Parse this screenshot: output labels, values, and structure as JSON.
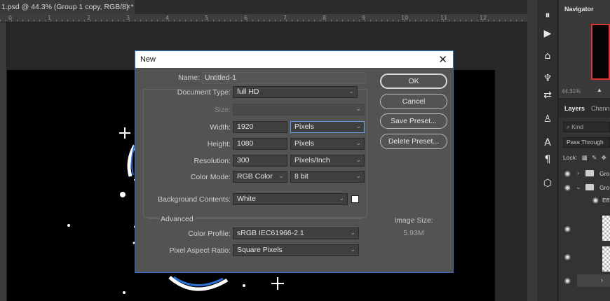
{
  "document_tab": {
    "title": "1.psd @ 44.3% (Group 1 copy, RGB/8) *",
    "close": "×"
  },
  "ruler": {
    "numbers": [
      "0",
      "1",
      "2",
      "3",
      "4",
      "5",
      "6",
      "7",
      "8",
      "9",
      "10",
      "11",
      "12"
    ]
  },
  "navigator": {
    "title": "Navigator",
    "zoom": "44.31%"
  },
  "layers": {
    "tab_layers": "Layers",
    "tab_channels": "Channe",
    "kind_placeholder": "Kind",
    "blend_mode": "Pass Through",
    "locks_label": "Lock:",
    "rows": [
      {
        "name": "Gro"
      },
      {
        "name": "Gro"
      },
      {
        "name": "Eff"
      }
    ]
  },
  "dialog": {
    "title": "New",
    "close": "✕",
    "name_label": "Name:",
    "name_value": "Untitled-1",
    "doc_type_label": "Document Type:",
    "doc_type_value": "full HD",
    "size_label": "Size:",
    "size_value": "",
    "width_label": "Width:",
    "width_value": "1920",
    "width_unit": "Pixels",
    "height_label": "Height:",
    "height_value": "1080",
    "height_unit": "Pixels",
    "resolution_label": "Resolution:",
    "resolution_value": "300",
    "resolution_unit": "Pixels/Inch",
    "color_mode_label": "Color Mode:",
    "color_mode_value": "RGB Color",
    "bit_depth_value": "8 bit",
    "bg_contents_label": "Background Contents:",
    "bg_contents_value": "White",
    "bg_swatch_color": "#ffffff",
    "advanced_label": "Advanced",
    "color_profile_label": "Color Profile:",
    "color_profile_value": "sRGB IEC61966-2.1",
    "pixel_aspect_label": "Pixel Aspect Ratio:",
    "pixel_aspect_value": "Square Pixels",
    "buttons": {
      "ok": "OK",
      "cancel": "Cancel",
      "save_preset": "Save Preset...",
      "delete_preset": "Delete Preset..."
    },
    "image_size_label": "Image Size:",
    "image_size_value": "5.93M"
  },
  "colors": {
    "accent": "#2f6fc7",
    "navigator_frame": "#dd3333"
  }
}
